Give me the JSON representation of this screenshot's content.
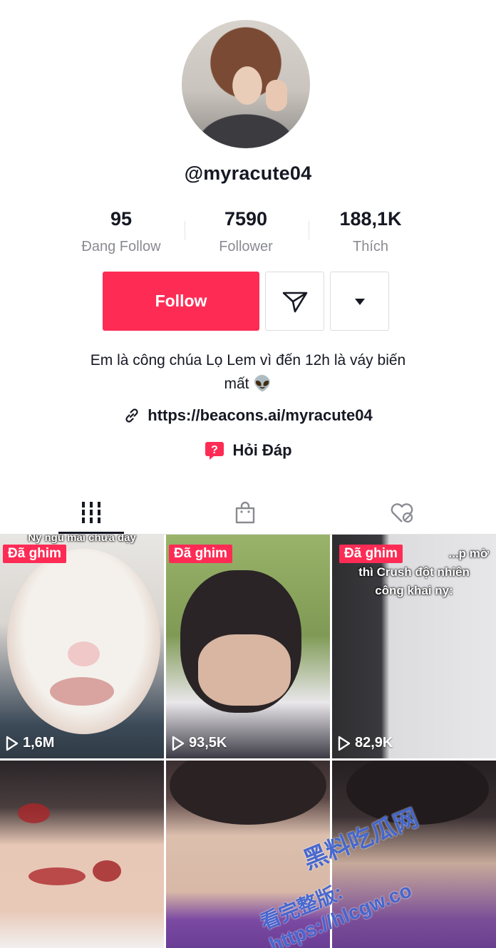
{
  "profile": {
    "username": "@myracute04",
    "stats": [
      {
        "value": "95",
        "label": "Đang Follow"
      },
      {
        "value": "7590",
        "label": "Follower"
      },
      {
        "value": "188,1K",
        "label": "Thích"
      }
    ],
    "follow_label": "Follow",
    "bio_line1": "Em là công chúa Lọ Lem vì đến 12h là váy biến",
    "bio_line2": "mất 👽",
    "link": "https://beacons.ai/myracute04",
    "qa_label": "Hỏi Đáp"
  },
  "tabs": [
    {
      "icon": "grid-icon",
      "active": true
    },
    {
      "icon": "shopping-bag-icon",
      "active": false
    },
    {
      "icon": "liked-hidden-icon",
      "active": false
    }
  ],
  "videos": [
    {
      "pinned": "Đã ghim",
      "views": "1,6M",
      "caption": "Ny ngủ mãi chưa dậy"
    },
    {
      "pinned": "Đã ghim",
      "views": "93,5K",
      "caption": ""
    },
    {
      "pinned": "Đã ghim",
      "views": "82,9K",
      "caption_line1": "...p mờ",
      "caption_line2": "thì Crush đột nhiên",
      "caption_line3": "công khai ny:"
    },
    {},
    {},
    {}
  ],
  "watermark": {
    "line1": "黑料吃瓜网",
    "line2": "看完整版: https://hlcgw.co"
  },
  "colors": {
    "accent": "#fe2c55",
    "text": "#161823",
    "muted": "#8a8b91"
  }
}
